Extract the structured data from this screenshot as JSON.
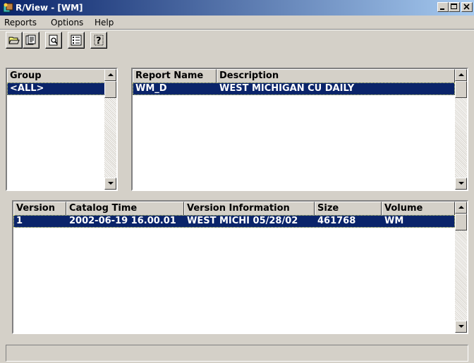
{
  "window": {
    "title": "R/View - [WM]"
  },
  "menubar": {
    "items": [
      {
        "label": "Reports"
      },
      {
        "label": "Options"
      },
      {
        "label": "Help"
      }
    ]
  },
  "toolbar": {
    "buttons": [
      "open-folder-icon",
      "catalog-icon",
      "print-preview-icon",
      "list-view-icon",
      "help-icon"
    ]
  },
  "group_list": {
    "header": "Group",
    "items": [
      "<ALL>"
    ],
    "selected_index": 0
  },
  "reports_table": {
    "columns": [
      "Report Name",
      "Description"
    ],
    "rows": [
      {
        "report_name": "WM_D",
        "description": "WEST MICHIGAN CU DAILY"
      }
    ]
  },
  "versions_table": {
    "columns": [
      "Version",
      "Catalog Time",
      "Version Information",
      "Size",
      "Volume"
    ],
    "rows": [
      {
        "version": "1",
        "catalog_time": "2002-06-19 16.00.01",
        "version_info": "WEST MICHI 05/28/02",
        "size": "461768",
        "volume": "WM"
      }
    ]
  },
  "colors": {
    "selection": "#0a246a",
    "titlebar_start": "#0a246a",
    "titlebar_end": "#a6caf0",
    "face": "#d4d0c8"
  }
}
